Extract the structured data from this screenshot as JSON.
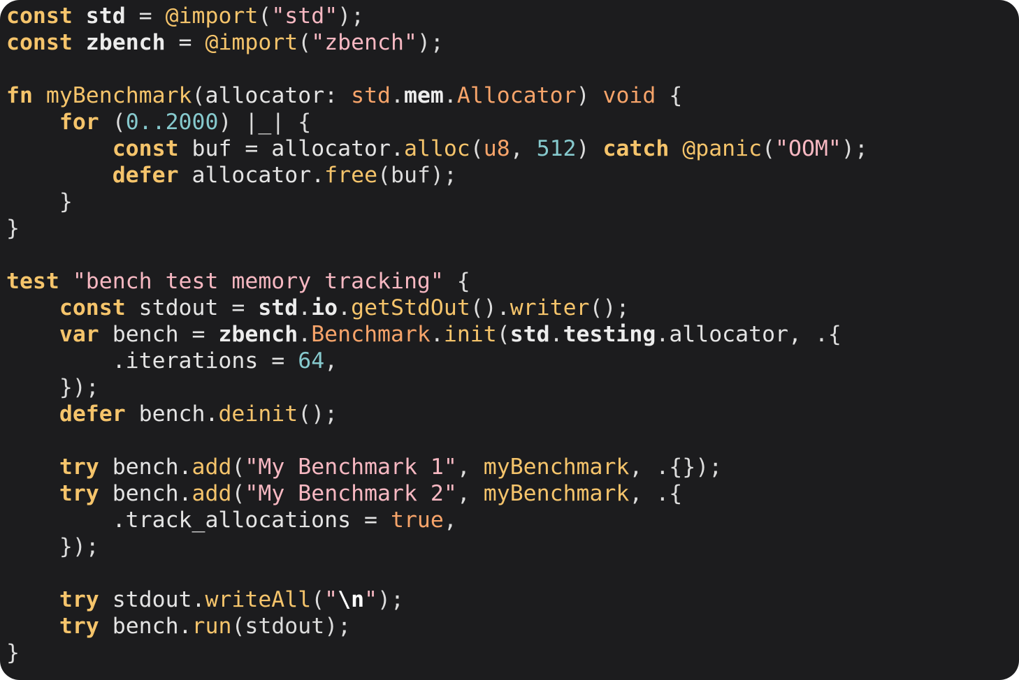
{
  "colors": {
    "background": "#1c1c1e",
    "keyword": "#f5c46b",
    "type": "#f7a46a",
    "string": "#f7b8c2",
    "number": "#86c9cd",
    "identifier": "#e4e4e4"
  },
  "lines": [
    [
      [
        "kw",
        "const"
      ],
      [
        "id",
        " "
      ],
      [
        "bld",
        "std"
      ],
      [
        "id",
        " = "
      ],
      [
        "bi",
        "@import"
      ],
      [
        "pu",
        "("
      ],
      [
        "str",
        "\"std\""
      ],
      [
        "pu",
        ");"
      ]
    ],
    [
      [
        "kw",
        "const"
      ],
      [
        "id",
        " "
      ],
      [
        "bld",
        "zbench"
      ],
      [
        "id",
        " = "
      ],
      [
        "bi",
        "@import"
      ],
      [
        "pu",
        "("
      ],
      [
        "str",
        "\"zbench\""
      ],
      [
        "pu",
        ");"
      ]
    ],
    [],
    [
      [
        "kw",
        "fn"
      ],
      [
        "id",
        " "
      ],
      [
        "fn",
        "myBenchmark"
      ],
      [
        "pu",
        "("
      ],
      [
        "id",
        "allocator: "
      ],
      [
        "ty",
        "std"
      ],
      [
        "pu",
        "."
      ],
      [
        "bld",
        "mem"
      ],
      [
        "pu",
        "."
      ],
      [
        "ty",
        "Allocator"
      ],
      [
        "pu",
        ") "
      ],
      [
        "ty",
        "void"
      ],
      [
        "pu",
        " {"
      ]
    ],
    [
      [
        "id",
        "    "
      ],
      [
        "kw",
        "for"
      ],
      [
        "pu",
        " ("
      ],
      [
        "num",
        "0..2000"
      ],
      [
        "pu",
        ") |_| {"
      ]
    ],
    [
      [
        "id",
        "        "
      ],
      [
        "kw",
        "const"
      ],
      [
        "id",
        " buf = allocator."
      ],
      [
        "fn",
        "alloc"
      ],
      [
        "pu",
        "("
      ],
      [
        "ty",
        "u8"
      ],
      [
        "pu",
        ", "
      ],
      [
        "num",
        "512"
      ],
      [
        "pu",
        ") "
      ],
      [
        "kw",
        "catch"
      ],
      [
        "id",
        " "
      ],
      [
        "bi",
        "@panic"
      ],
      [
        "pu",
        "("
      ],
      [
        "str",
        "\"OOM\""
      ],
      [
        "pu",
        ");"
      ]
    ],
    [
      [
        "id",
        "        "
      ],
      [
        "kw",
        "defer"
      ],
      [
        "id",
        " allocator."
      ],
      [
        "fn",
        "free"
      ],
      [
        "pu",
        "(buf);"
      ]
    ],
    [
      [
        "pu",
        "    }"
      ]
    ],
    [
      [
        "pu",
        "}"
      ]
    ],
    [],
    [
      [
        "kw",
        "test"
      ],
      [
        "id",
        " "
      ],
      [
        "str",
        "\"bench test memory tracking\""
      ],
      [
        "pu",
        " {"
      ]
    ],
    [
      [
        "id",
        "    "
      ],
      [
        "kw",
        "const"
      ],
      [
        "id",
        " stdout = "
      ],
      [
        "bld",
        "std"
      ],
      [
        "pu",
        "."
      ],
      [
        "bld",
        "io"
      ],
      [
        "pu",
        "."
      ],
      [
        "fn",
        "getStdOut"
      ],
      [
        "pu",
        "()."
      ],
      [
        "fn",
        "writer"
      ],
      [
        "pu",
        "();"
      ]
    ],
    [
      [
        "id",
        "    "
      ],
      [
        "kw",
        "var"
      ],
      [
        "id",
        " bench = "
      ],
      [
        "bld",
        "zbench"
      ],
      [
        "pu",
        "."
      ],
      [
        "ty",
        "Benchmark"
      ],
      [
        "pu",
        "."
      ],
      [
        "fn",
        "init"
      ],
      [
        "pu",
        "("
      ],
      [
        "bld",
        "std"
      ],
      [
        "pu",
        "."
      ],
      [
        "bld",
        "testing"
      ],
      [
        "pu",
        "."
      ],
      [
        "id",
        "allocator, "
      ],
      [
        "pu",
        ".{"
      ]
    ],
    [
      [
        "id",
        "        .iterations = "
      ],
      [
        "num",
        "64"
      ],
      [
        "pu",
        ","
      ]
    ],
    [
      [
        "pu",
        "    });"
      ]
    ],
    [
      [
        "id",
        "    "
      ],
      [
        "kw",
        "defer"
      ],
      [
        "id",
        " bench."
      ],
      [
        "fn",
        "deinit"
      ],
      [
        "pu",
        "();"
      ]
    ],
    [],
    [
      [
        "id",
        "    "
      ],
      [
        "kw",
        "try"
      ],
      [
        "id",
        " bench."
      ],
      [
        "fn",
        "add"
      ],
      [
        "pu",
        "("
      ],
      [
        "str",
        "\"My Benchmark 1\""
      ],
      [
        "pu",
        ", "
      ],
      [
        "fn",
        "myBenchmark"
      ],
      [
        "pu",
        ", .{});"
      ]
    ],
    [
      [
        "id",
        "    "
      ],
      [
        "kw",
        "try"
      ],
      [
        "id",
        " bench."
      ],
      [
        "fn",
        "add"
      ],
      [
        "pu",
        "("
      ],
      [
        "str",
        "\"My Benchmark 2\""
      ],
      [
        "pu",
        ", "
      ],
      [
        "fn",
        "myBenchmark"
      ],
      [
        "pu",
        ", .{"
      ]
    ],
    [
      [
        "id",
        "        .track_allocations = "
      ],
      [
        "bool",
        "true"
      ],
      [
        "pu",
        ","
      ]
    ],
    [
      [
        "pu",
        "    });"
      ]
    ],
    [],
    [
      [
        "id",
        "    "
      ],
      [
        "kw",
        "try"
      ],
      [
        "id",
        " stdout."
      ],
      [
        "fn",
        "writeAll"
      ],
      [
        "pu",
        "("
      ],
      [
        "str",
        "\""
      ],
      [
        "esc",
        "\\n"
      ],
      [
        "str",
        "\""
      ],
      [
        "pu",
        ");"
      ]
    ],
    [
      [
        "id",
        "    "
      ],
      [
        "kw",
        "try"
      ],
      [
        "id",
        " bench."
      ],
      [
        "fn",
        "run"
      ],
      [
        "pu",
        "(stdout);"
      ]
    ],
    [
      [
        "pu",
        "}"
      ]
    ]
  ]
}
